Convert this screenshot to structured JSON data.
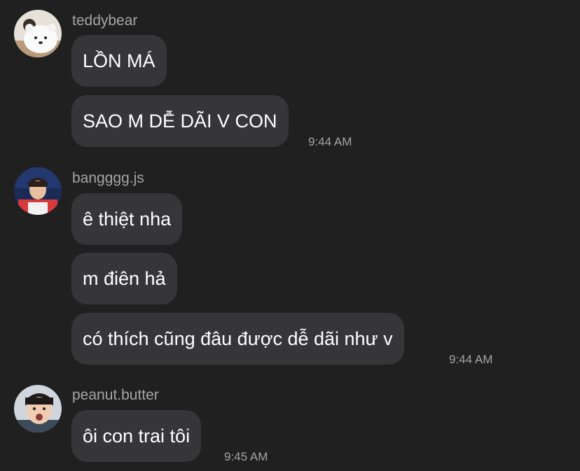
{
  "messages": [
    {
      "user": "teddybear",
      "avatar_icon": "teddy-bear-plush-avatar-icon",
      "bubbles": [
        "LỒN MÁ",
        "SAO M DỄ DÃI V CON"
      ],
      "time": "9:44 AM"
    },
    {
      "user": "bangggg.js",
      "avatar_icon": "gamer-avatar-icon",
      "bubbles": [
        "ê thiệt nha",
        "m điên hả",
        "có thích cũng đâu được dễ dãi như v"
      ],
      "time": "9:44 AM"
    },
    {
      "user": "peanut.butter",
      "avatar_icon": "surprised-boy-avatar-icon",
      "bubbles": [
        "ôi con trai tôi"
      ],
      "time": "9:45 AM"
    }
  ],
  "colors": {
    "background": "#202021",
    "bubble": "#363638",
    "text": "#ffffff",
    "meta": "#a5a5a7"
  }
}
